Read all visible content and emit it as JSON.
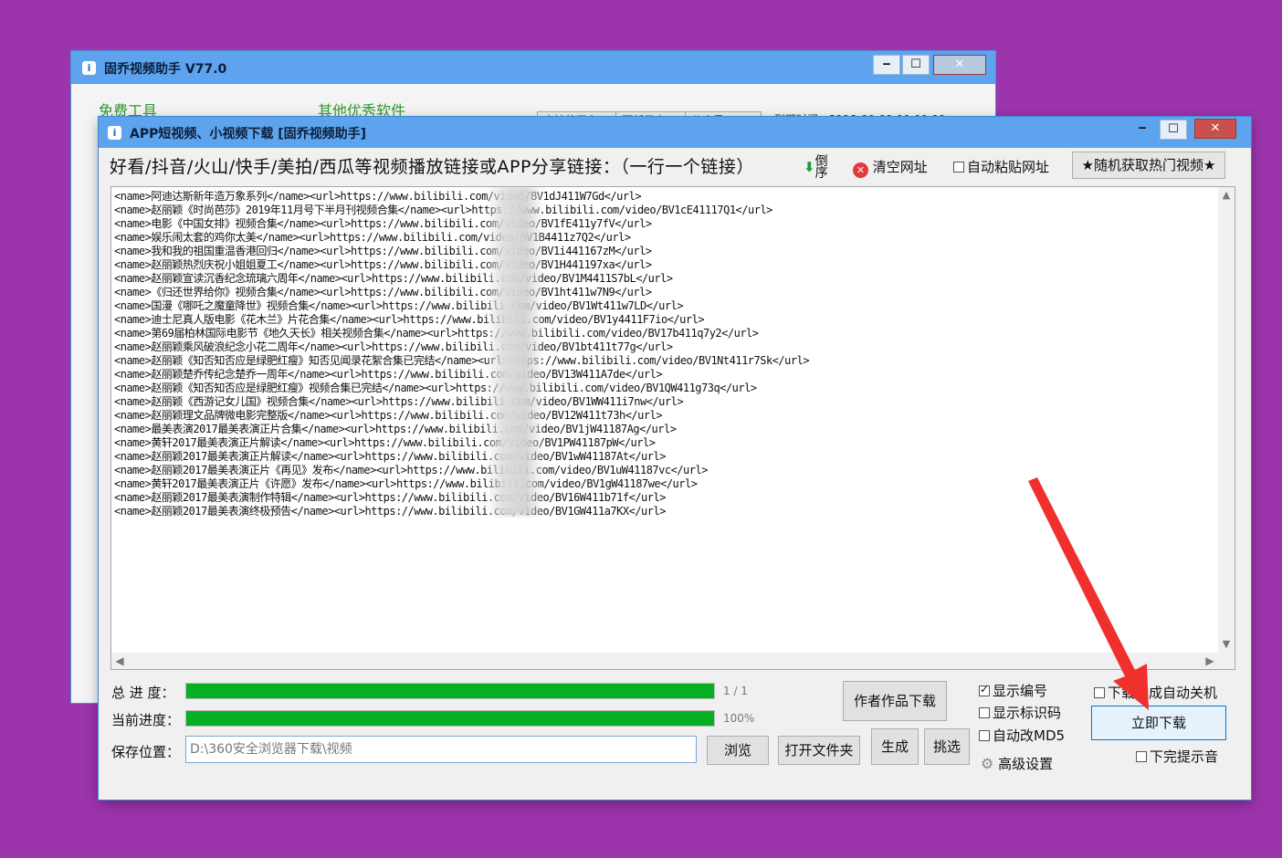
{
  "back_window": {
    "title": "固乔视频助手 V77.0",
    "free_tools": "免费工具",
    "other_software": "其他优秀软件",
    "tabs": [
      "支持的平台",
      "更新日志",
      "公众号"
    ],
    "expire": "到期时间：2118-09-09 09:09:09",
    "controls": {
      "minimize": "‒",
      "maximize": "☐",
      "close": "✕"
    }
  },
  "front_window": {
    "title": "APP短视频、小视频下载 [固乔视频助手]",
    "controls": {
      "minimize": "‒",
      "maximize": "☐",
      "close": "✕"
    },
    "prompt": "好看/抖音/火山/快手/美拍/西瓜等视频播放链接或APP分享链接：（一行一个链接）",
    "reverse_label": "倒序",
    "clear_label": "清空网址",
    "auto_paste_label": "自动粘贴网址",
    "hot_video_label": "★随机获取热门视频★",
    "links_text": "<name>阿迪达斯新年造万象系列</name><url>https://www.bilibili.com/video/BV1dJ411W7Gd</url>\n<name>赵丽颖《时尚芭莎》2019年11月号下半月刊视频合集</name><url>https://www.bilibili.com/video/BV1cE41117Q1</url>\n<name>电影《中国女排》视频合集</name><url>https://www.bilibili.com/video/BV1fE411y7fV</url>\n<name>娱乐闹太套的鸡你太美</name><url>https://www.bilibili.com/video/BV1B4411z7Q2</url>\n<name>我和我的祖国重温香港回归</name><url>https://www.bilibili.com/video/BV1i441167zM</url>\n<name>赵丽颖热烈庆祝小姐姐夏工</name><url>https://www.bilibili.com/video/BV1H441197xa</url>\n<name>赵丽颖宣读沉香纪念琉璃六周年</name><url>https://www.bilibili.com/video/BV1M4411S7bL</url>\n<name>《归还世界给你》视频合集</name><url>https://www.bilibili.com/video/BV1ht411w7N9</url>\n<name>国漫《哪吒之魔童降世》视频合集</name><url>https://www.bilibili.com/video/BV1Wt411w7LD</url>\n<name>迪士尼真人版电影《花木兰》片花合集</name><url>https://www.bilibili.com/video/BV1y4411F7io</url>\n<name>第69届柏林国际电影节《地久天长》相关视频合集</name><url>https://www.bilibili.com/video/BV17b411q7y2</url>\n<name>赵丽颖乘风破浪纪念小花二周年</name><url>https://www.bilibili.com/video/BV1bt411t77g</url>\n<name>赵丽颖《知否知否应是绿肥红瘦》知否见闻录花絮合集已完结</name><url>https://www.bilibili.com/video/BV1Nt411r7Sk</url>\n<name>赵丽颖楚乔传纪念楚乔一周年</name><url>https://www.bilibili.com/video/BV13W411A7de</url>\n<name>赵丽颖《知否知否应是绿肥红瘦》视频合集已完结</name><url>https://www.bilibili.com/video/BV1QW411g73q</url>\n<name>赵丽颖《西游记女儿国》视频合集</name><url>https://www.bilibili.com/video/BV1WW411i7nw</url>\n<name>赵丽颖理文品牌微电影完整版</name><url>https://www.bilibili.com/video/BV12W411t73h</url>\n<name>最美表演2017最美表演正片合集</name><url>https://www.bilibili.com/video/BV1jW41187Ag</url>\n<name>黄轩2017最美表演正片解读</name><url>https://www.bilibili.com/video/BV1PW41187pW</url>\n<name>赵丽颖2017最美表演正片解读</name><url>https://www.bilibili.com/video/BV1wW41187At</url>\n<name>赵丽颖2017最美表演正片《再见》发布</name><url>https://www.bilibili.com/video/BV1uW41187vc</url>\n<name>黄轩2017最美表演正片《许愿》发布</name><url>https://www.bilibili.com/video/BV1gW41187we</url>\n<name>赵丽颖2017最美表演制作特辑</name><url>https://www.bilibili.com/video/BV16W411b71f</url>\n<name>赵丽颖2017最美表演终极预告</name><url>https://www.bilibili.com/video/BV1GW411a7KX</url>",
    "total_progress_label": "总 进 度：",
    "total_progress_value": 1.0,
    "total_progress_text": "1 / 1",
    "current_progress_label": "当前进度：",
    "current_progress_value": 1.0,
    "current_progress_text": "100%",
    "save_location_label": "保存位置：",
    "save_path": "D:\\360安全浏览器下载\\视频",
    "browse_label": "浏览",
    "open_folder_label": "打开文件夹",
    "author_works_label": "作者作品下载",
    "generate_label": "生成",
    "pick_label": "挑选",
    "show_number_label": "显示编号",
    "show_number_checked": true,
    "show_id_label": "显示标识码",
    "auto_md5_label": "自动改MD5",
    "advanced_label": "高级设置",
    "auto_shutdown_label": "下载完成自动关机",
    "download_now_label": "立即下载",
    "done_sound_label": "下完提示音"
  },
  "colors": {
    "desktop": "#9c34ac",
    "titlebar": "#5ea3ee",
    "progress": "#06b025",
    "annotation_arrow": "#f0302c"
  }
}
